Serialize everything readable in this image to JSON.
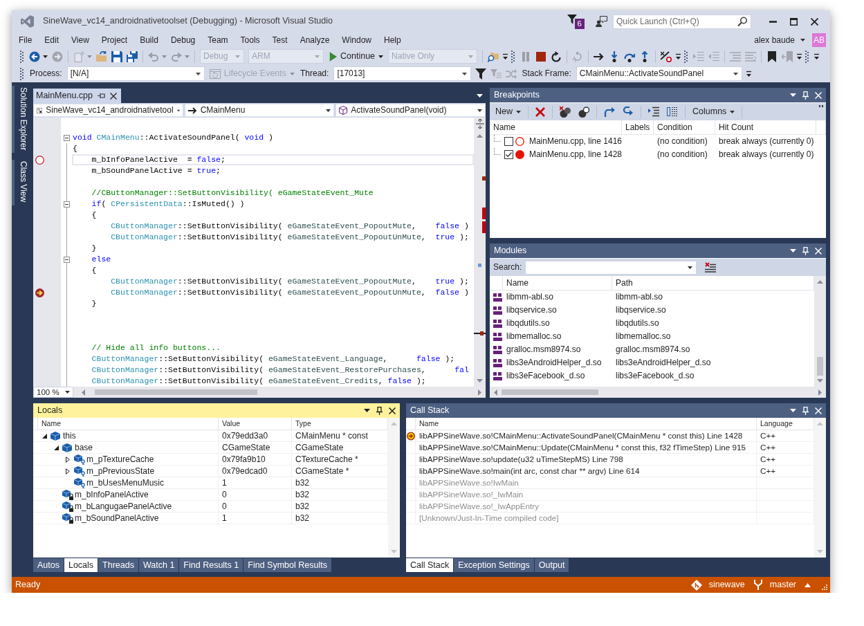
{
  "window": {
    "title": "SineWave_vc14_androidnativetoolset (Debugging) - Microsoft Visual Studio"
  },
  "title_bar": {
    "notifications": "6",
    "quick_launch": {
      "placeholder": "Quick Launch (Ctrl+Q)"
    }
  },
  "menu": [
    "File",
    "Edit",
    "View",
    "Project",
    "Build",
    "Debug",
    "Team",
    "Tools",
    "Test",
    "Analyze",
    "Window",
    "Help"
  ],
  "account": {
    "name": "alex baude",
    "initials": "AB"
  },
  "toolbar": [
    {
      "kind": "grip"
    },
    {
      "kind": "icon",
      "disabled": false,
      "dropdown": true
    },
    {
      "kind": "icon",
      "disabled": true,
      "dropdown": false
    },
    {
      "kind": "separator"
    },
    {
      "kind": "icon",
      "disabled": true,
      "dropdown": true
    },
    {
      "kind": "icon",
      "disabled": false,
      "dropdown": false
    },
    {
      "kind": "icon",
      "disabled": false,
      "dropdown": false
    },
    {
      "kind": "icon",
      "disabled": false,
      "dropdown": false
    },
    {
      "kind": "separator"
    },
    {
      "kind": "icon",
      "disabled": true,
      "dropdown": true
    },
    {
      "kind": "icon",
      "disabled": true,
      "dropdown": true
    },
    {
      "kind": "separator"
    },
    {
      "kind": "combo",
      "value": "Debug",
      "disabled": true
    },
    {
      "kind": "combo",
      "value": "ARM",
      "disabled": true
    },
    {
      "kind": "button",
      "label": "Continue",
      "disabled": false,
      "dropdown": true
    },
    {
      "kind": "combo",
      "value": "Native Only",
      "disabled": true
    },
    {
      "kind": "separator"
    },
    {
      "kind": "icon",
      "disabled": false,
      "dropdown": false
    },
    {
      "kind": "overflow"
    },
    {
      "kind": "grip"
    },
    {
      "kind": "icon",
      "disabled": true,
      "dropdown": false
    },
    {
      "kind": "icon",
      "disabled": false,
      "dropdown": false
    },
    {
      "kind": "icon",
      "disabled": false,
      "dropdown": false
    },
    {
      "kind": "separator"
    },
    {
      "kind": "icon",
      "disabled": true,
      "dropdown": false
    },
    {
      "kind": "separator"
    },
    {
      "kind": "icon",
      "disabled": false,
      "dropdown": false
    },
    {
      "kind": "icon",
      "disabled": false,
      "dropdown": false
    },
    {
      "kind": "icon",
      "disabled": false,
      "dropdown": false
    },
    {
      "kind": "icon",
      "disabled": false,
      "dropdown": false
    },
    {
      "kind": "separator"
    },
    {
      "kind": "icon",
      "disabled": false,
      "dropdown": false
    },
    {
      "kind": "overflow"
    },
    {
      "kind": "grip"
    },
    {
      "kind": "icon",
      "disabled": true,
      "dropdown": false
    },
    {
      "kind": "icon",
      "disabled": true,
      "dropdown": false
    },
    {
      "kind": "separator"
    },
    {
      "kind": "icon",
      "disabled": true,
      "dropdown": false
    },
    {
      "kind": "icon",
      "disabled": true,
      "dropdown": false
    },
    {
      "kind": "separator"
    },
    {
      "kind": "icon",
      "disabled": false,
      "dropdown": false
    },
    {
      "kind": "icon",
      "disabled": true,
      "dropdown": false
    },
    {
      "kind": "overflow"
    },
    {
      "kind": "grip"
    },
    {
      "kind": "overflow"
    }
  ],
  "debug_location_toolbar": [
    {
      "kind": "grip"
    },
    {
      "kind": "label",
      "text": "Process:"
    },
    {
      "kind": "combo",
      "value": "[N/A]",
      "disabled": false
    },
    {
      "kind": "button",
      "label": "Lifecycle Events",
      "disabled": true,
      "dropdown": true
    },
    {
      "kind": "label",
      "text": "Thread:"
    },
    {
      "kind": "combo",
      "value": "[17013]",
      "disabled": false
    },
    {
      "kind": "icon",
      "disabled": false,
      "dropdown": false
    },
    {
      "kind": "icon",
      "disabled": true,
      "dropdown": false
    },
    {
      "kind": "icon",
      "disabled": true,
      "dropdown": false
    },
    {
      "kind": "label",
      "text": "Stack Frame:"
    },
    {
      "kind": "combo",
      "value": "CMainMenu::ActivateSoundPanel",
      "disabled": false
    },
    {
      "kind": "overflow"
    }
  ],
  "side_tabs": [
    "Solution Explorer",
    "Class View"
  ],
  "editor": {
    "tab": "MainMenu.cpp",
    "navigation": [
      "SineWave_vc14_androidnativetool",
      "CMainMenu",
      "ActivateSoundPanel(void)"
    ],
    "zoom": "100 %",
    "lines": [
      {
        "breakpoint": false,
        "collapsible": true,
        "caret_line": false,
        "segments": [
          {
            "kind": "keyword",
            "text": "void "
          },
          {
            "kind": "type",
            "text": "CMainMenu"
          },
          {
            "kind": "plain",
            "text": "::ActivateSoundPanel( "
          },
          {
            "kind": "keyword",
            "text": "void"
          },
          {
            "kind": "plain",
            "text": " )"
          }
        ]
      },
      {
        "breakpoint": false,
        "collapsible": false,
        "caret_line": false,
        "segments": [
          {
            "kind": "plain",
            "text": "{"
          }
        ]
      },
      {
        "breakpoint": true,
        "enabled": false,
        "current": false,
        "collapsible": false,
        "caret_line": true,
        "segments": [
          {
            "kind": "plain",
            "text": "    m_bInfoPanelActive  = "
          },
          {
            "kind": "keyword",
            "text": "false"
          },
          {
            "kind": "plain",
            "text": ";"
          }
        ]
      },
      {
        "breakpoint": false,
        "collapsible": false,
        "caret_line": false,
        "segments": [
          {
            "kind": "plain",
            "text": "    m_bSoundPanelActive = "
          },
          {
            "kind": "keyword",
            "text": "true"
          },
          {
            "kind": "plain",
            "text": ";"
          }
        ]
      },
      {
        "breakpoint": false,
        "collapsible": false,
        "caret_line": false
      },
      {
        "breakpoint": false,
        "collapsible": false,
        "caret_line": false,
        "segments": [
          {
            "kind": "comment",
            "text": "    //CButtonManager::SetButtonVisibility( eGameStateEvent_Mute"
          }
        ]
      },
      {
        "breakpoint": false,
        "collapsible": true,
        "caret_line": false,
        "segments": [
          {
            "kind": "keyword",
            "text": "    if"
          },
          {
            "kind": "plain",
            "text": "( "
          },
          {
            "kind": "type",
            "text": "CPersistentData"
          },
          {
            "kind": "plain",
            "text": "::IsMuted() )"
          }
        ]
      },
      {
        "breakpoint": false,
        "collapsible": false,
        "caret_line": false,
        "segments": [
          {
            "kind": "plain",
            "text": "    {"
          }
        ]
      },
      {
        "breakpoint": false,
        "collapsible": false,
        "caret_line": false,
        "segments": [
          {
            "kind": "type",
            "text": "        CButtonManager"
          },
          {
            "kind": "plain",
            "text": "::SetButtonVisibility( "
          },
          {
            "kind": "enum",
            "text": "eGameStateEvent_PopoutMute"
          },
          {
            "kind": "plain",
            "text": ",    "
          },
          {
            "kind": "keyword",
            "text": "false"
          },
          {
            "kind": "plain",
            "text": " )"
          }
        ]
      },
      {
        "breakpoint": false,
        "collapsible": false,
        "caret_line": false,
        "segments": [
          {
            "kind": "type",
            "text": "        CButtonManager"
          },
          {
            "kind": "plain",
            "text": "::SetButtonVisibility( "
          },
          {
            "kind": "enum",
            "text": "eGameStateEvent_PopoutUnMute"
          },
          {
            "kind": "plain",
            "text": ",  "
          },
          {
            "kind": "keyword",
            "text": "true"
          },
          {
            "kind": "plain",
            "text": " );"
          }
        ]
      },
      {
        "breakpoint": false,
        "collapsible": false,
        "caret_line": false,
        "segments": [
          {
            "kind": "plain",
            "text": "    }"
          }
        ]
      },
      {
        "breakpoint": false,
        "collapsible": true,
        "caret_line": false,
        "segments": [
          {
            "kind": "keyword",
            "text": "    else"
          }
        ]
      },
      {
        "breakpoint": false,
        "collapsible": false,
        "caret_line": false,
        "segments": [
          {
            "kind": "plain",
            "text": "    {"
          }
        ]
      },
      {
        "breakpoint": false,
        "collapsible": false,
        "caret_line": false,
        "segments": [
          {
            "kind": "type",
            "text": "        CButtonManager"
          },
          {
            "kind": "plain",
            "text": "::SetButtonVisibility( "
          },
          {
            "kind": "enum",
            "text": "eGameStateEvent_PopoutMute"
          },
          {
            "kind": "plain",
            "text": ",    "
          },
          {
            "kind": "keyword",
            "text": "true"
          },
          {
            "kind": "plain",
            "text": " );"
          }
        ]
      },
      {
        "breakpoint": true,
        "enabled": true,
        "current": true,
        "collapsible": false,
        "caret_line": false,
        "segments": [
          {
            "kind": "type",
            "text": "        CButtonManager"
          },
          {
            "kind": "plain",
            "text": "::SetButtonVisibility( "
          },
          {
            "kind": "enum",
            "text": "eGameStateEvent_PopoutUnMute"
          },
          {
            "kind": "plain",
            "text": ",  "
          },
          {
            "kind": "keyword",
            "text": "false"
          },
          {
            "kind": "plain",
            "text": " )"
          }
        ]
      },
      {
        "breakpoint": false,
        "collapsible": false,
        "caret_line": false,
        "segments": [
          {
            "kind": "plain",
            "text": "    }"
          }
        ]
      },
      {
        "breakpoint": false,
        "collapsible": false,
        "caret_line": false
      },
      {
        "breakpoint": false,
        "collapsible": false,
        "caret_line": false
      },
      {
        "breakpoint": false,
        "collapsible": false,
        "caret_line": false
      },
      {
        "breakpoint": false,
        "collapsible": false,
        "caret_line": false,
        "segments": [
          {
            "kind": "comment",
            "text": "    // Hide all info buttons..."
          }
        ]
      },
      {
        "breakpoint": false,
        "collapsible": false,
        "caret_line": false,
        "segments": [
          {
            "kind": "type",
            "text": "    CButtonManager"
          },
          {
            "kind": "plain",
            "text": "::SetButtonVisibility( "
          },
          {
            "kind": "enum",
            "text": "eGameStateEvent_Language"
          },
          {
            "kind": "plain",
            "text": ",      "
          },
          {
            "kind": "keyword",
            "text": "false"
          },
          {
            "kind": "plain",
            "text": " );"
          }
        ]
      },
      {
        "breakpoint": false,
        "collapsible": false,
        "caret_line": false,
        "segments": [
          {
            "kind": "type",
            "text": "    CButtonManager"
          },
          {
            "kind": "plain",
            "text": "::SetButtonVisibility( "
          },
          {
            "kind": "enum",
            "text": "eGameStateEvent_RestorePurchases"
          },
          {
            "kind": "plain",
            "text": ",      "
          },
          {
            "kind": "keyword",
            "text": "fal"
          }
        ]
      },
      {
        "breakpoint": false,
        "collapsible": false,
        "caret_line": false,
        "segments": [
          {
            "kind": "type",
            "text": "    CButtonManager"
          },
          {
            "kind": "plain",
            "text": "::SetButtonVisibility( "
          },
          {
            "kind": "enum",
            "text": "eGameStateEvent_Credits"
          },
          {
            "kind": "plain",
            "text": ", "
          },
          {
            "kind": "keyword",
            "text": "false"
          },
          {
            "kind": "plain",
            "text": " );"
          }
        ]
      }
    ]
  },
  "breakpoints": {
    "title": "Breakpoints",
    "focused": false,
    "toolbar": {
      "new_button": "New",
      "columns_button": "Columns"
    },
    "columns": [
      "Name",
      "Labels",
      "Condition",
      "Hit Count"
    ],
    "rows": [
      {
        "checked": false,
        "name": "MainMenu.cpp, line 1416",
        "condition": "(no condition)",
        "hit_count": "break always (currently 0)"
      },
      {
        "checked": true,
        "name": "MainMenu.cpp, line 1428",
        "condition": "(no condition)",
        "hit_count": "break always (currently 0)"
      }
    ]
  },
  "modules": {
    "title": "Modules",
    "focused": false,
    "search_label": "Search:",
    "columns": [
      "Name",
      "Path"
    ],
    "rows": [
      {
        "name": "libmm-abl.so",
        "path": "libmm-abl.so"
      },
      {
        "name": "libqservice.so",
        "path": "libqservice.so"
      },
      {
        "name": "libqdutils.so",
        "path": "libqdutils.so"
      },
      {
        "name": "libmemalloc.so",
        "path": "libmemalloc.so"
      },
      {
        "name": "gralloc.msm8974.so",
        "path": "gralloc.msm8974.so"
      },
      {
        "name": "libs3eAndroidHelper_d.so",
        "path": "libs3eAndroidHelper_d.so"
      },
      {
        "name": "libs3eFacebook_d.so",
        "path": "libs3eFacebook_d.so"
      }
    ]
  },
  "locals": {
    "title": "Locals",
    "focused": true,
    "columns": [
      "Name",
      "Value",
      "Type"
    ],
    "rows": [
      {
        "kind": "object",
        "name": "this",
        "value": "0x79edd3a0",
        "type": "CMainMenu * const",
        "expanded": true,
        "children": [
          {
            "kind": "object",
            "name": "base",
            "value": "CGameState",
            "type": "CGameState",
            "expanded": true,
            "children": [
              {
                "kind": "protected_field",
                "name": "m_pTextureCache",
                "value": "0x79fa9b10",
                "type": "CTextureCache *",
                "expanded": false
              },
              {
                "kind": "protected_field",
                "name": "m_pPreviousState",
                "value": "0x79edcad0",
                "type": "CGameState *",
                "expanded": false
              },
              {
                "kind": "protected_field",
                "name": "m_bUsesMenuMusic",
                "value": "1",
                "type": "b32"
              }
            ]
          },
          {
            "kind": "private_field",
            "name": "m_bInfoPanelActive",
            "value": "0",
            "type": "b32"
          },
          {
            "kind": "private_field",
            "name": "m_bLangugaePanelActive",
            "value": "0",
            "type": "b32"
          },
          {
            "kind": "private_field",
            "name": "m_bSoundPanelActive",
            "value": "1",
            "type": "b32"
          }
        ]
      }
    ],
    "tabs": [
      {
        "label": "Autos",
        "selected": false
      },
      {
        "label": "Locals",
        "selected": true
      },
      {
        "label": "Threads",
        "selected": false
      },
      {
        "label": "Watch 1",
        "selected": false
      },
      {
        "label": "Find Results 1",
        "selected": false
      },
      {
        "label": "Find Symbol Results",
        "selected": false
      }
    ]
  },
  "call_stack": {
    "title": "Call Stack",
    "focused": false,
    "columns": [
      "Name",
      "Language"
    ],
    "rows": [
      {
        "current": true,
        "dimmed": false,
        "name": "libAPPSineWave.so!CMainMenu::ActivateSoundPanel(CMainMenu * const this) Line 1428",
        "language": "C++"
      },
      {
        "current": false,
        "dimmed": false,
        "name": "libAPPSineWave.so!CMainMenu::Update(CMainMenu * const this, f32 fTimeStep) Line 915",
        "language": "C++"
      },
      {
        "current": false,
        "dimmed": false,
        "name": "libAPPSineWave.so!update(u32 uTimeStepMS) Line 798",
        "language": "C++"
      },
      {
        "current": false,
        "dimmed": false,
        "name": "libAPPSineWave.so!main(int arc, const char ** argv) Line 614",
        "language": "C++"
      },
      {
        "current": false,
        "dimmed": true,
        "name": "libAPPSineWave.so!IwMain"
      },
      {
        "current": false,
        "dimmed": true,
        "name": "libAPPSineWave.so!_IwMain"
      },
      {
        "current": false,
        "dimmed": true,
        "name": "libAPPSineWave.so!_IwAppEntry"
      },
      {
        "current": false,
        "dimmed": true,
        "name": "[Unknown/Just-In-Time compiled code]"
      }
    ],
    "tabs": [
      {
        "label": "Call Stack",
        "selected": true
      },
      {
        "label": "Exception Settings",
        "selected": false
      },
      {
        "label": "Output",
        "selected": false
      }
    ]
  },
  "status_bar": {
    "text": "Ready",
    "repository": "sinewave",
    "branch": "master"
  }
}
